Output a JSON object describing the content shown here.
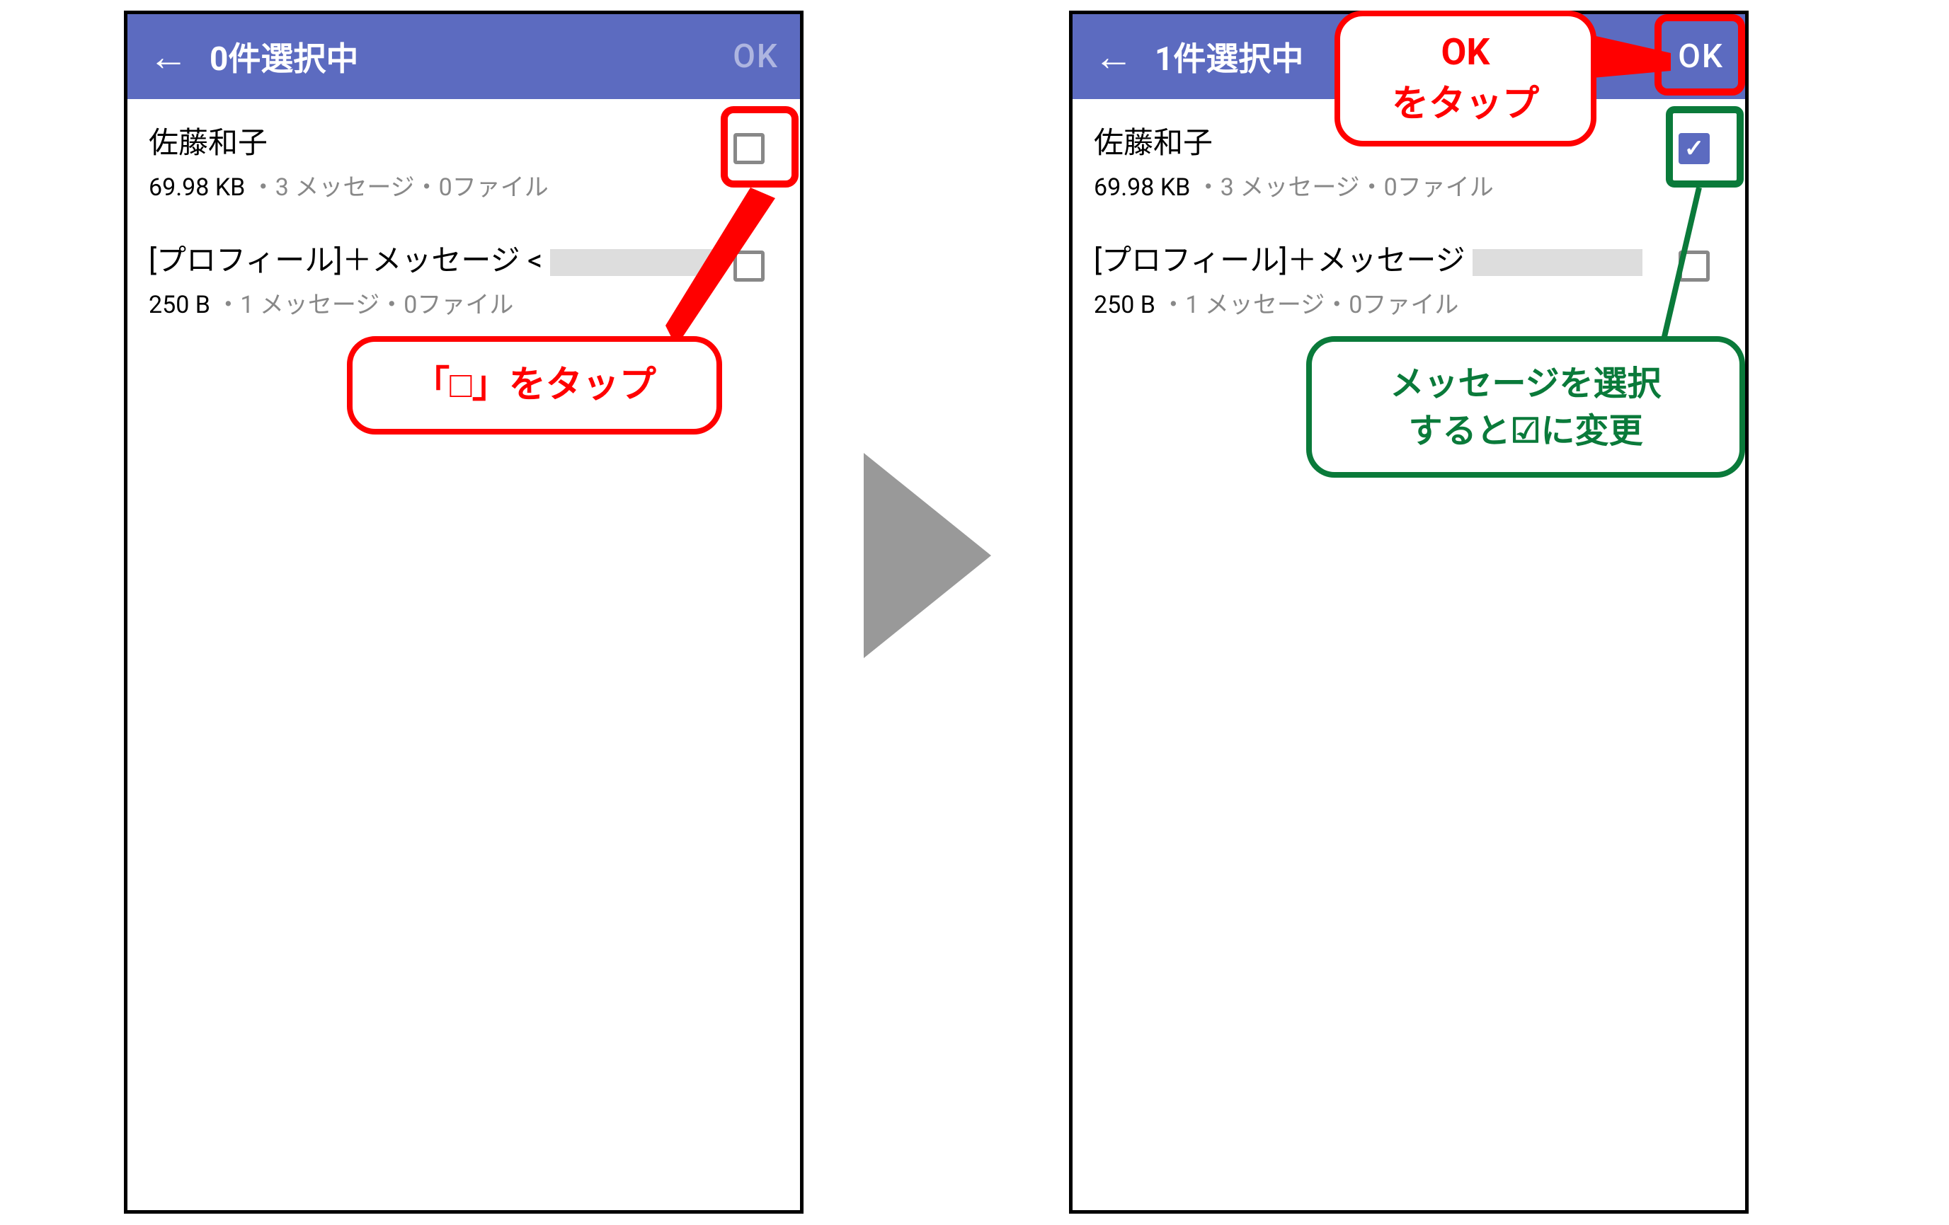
{
  "left": {
    "header": {
      "title": "0件選択中",
      "ok": "OK"
    },
    "items": [
      {
        "name": "佐藤和子",
        "size": "69.98 KB",
        "meta": " ・3 メッセージ・0ファイル"
      },
      {
        "name": "[プロフィール]＋メッセージ < ",
        "size": "250 B",
        "meta": " ・1 メッセージ・0ファイル"
      }
    ],
    "callout": "「□」をタップ"
  },
  "right": {
    "header": {
      "title": "1件選択中",
      "ok": "OK"
    },
    "items": [
      {
        "name": "佐藤和子",
        "size": "69.98 KB",
        "meta": " ・3 メッセージ・0ファイル"
      },
      {
        "name": "[プロフィール]＋メッセージ ",
        "size": "250 B",
        "meta": " ・1 メッセージ・0ファイル"
      }
    ],
    "callout_ok_line1": "OK",
    "callout_ok_line2": "をタップ",
    "callout_green_line1": "メッセージを選択",
    "callout_green_line2": "すると☑に変更"
  }
}
